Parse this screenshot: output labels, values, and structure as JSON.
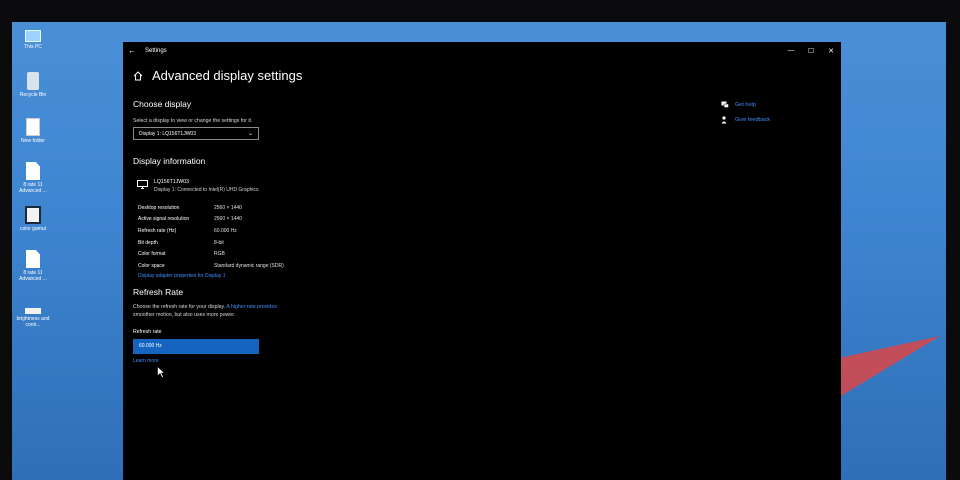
{
  "desktop": {
    "icons": [
      {
        "label": "This PC",
        "glyph": "pc"
      },
      {
        "label": "Recycle Bin",
        "glyph": "bin"
      },
      {
        "label": "New folder",
        "glyph": "folder"
      },
      {
        "label": "8 rate 11 Advanced ...",
        "glyph": "doc"
      },
      {
        "label": "color gamut",
        "glyph": "img"
      },
      {
        "label": "8 rate 11 Advanced ...",
        "glyph": "doc"
      },
      {
        "label": "brightness and contr...",
        "glyph": "white"
      }
    ]
  },
  "window": {
    "title": "Settings",
    "back_glyph": "←",
    "minimize_glyph": "—",
    "maximize_glyph": "☐",
    "close_glyph": "✕"
  },
  "page": {
    "title": "Advanced display settings",
    "choose_display": {
      "heading": "Choose display",
      "description": "Select a display to view or change the settings for it.",
      "selected": "Display 1: LQ156T1JW03"
    },
    "display_info": {
      "heading": "Display information",
      "name": "LQ156T1JW03",
      "connection": "Display 1: Connected to Intel(R) UHD Graphics",
      "rows": [
        {
          "key": "Desktop resolution",
          "value": "2560 × 1440"
        },
        {
          "key": "Active signal resolution",
          "value": "2560 × 1440"
        },
        {
          "key": "Refresh rate (Hz)",
          "value": "60.000 Hz"
        },
        {
          "key": "Bit depth",
          "value": "8-bit"
        },
        {
          "key": "Color format",
          "value": "RGB"
        },
        {
          "key": "Color space",
          "value": "Standard dynamic range (SDR)"
        }
      ],
      "adapter_link": "Display adapter properties for Display 1"
    },
    "refresh_rate": {
      "heading": "Refresh Rate",
      "description": "Choose the refresh rate for your display. ",
      "description_link": "A higher rate provides",
      "description_end": "smoother motion, but also uses more power.",
      "label": "Refresh rate",
      "selected": "60.000 Hz",
      "learn_more": "Learn more"
    }
  },
  "help": {
    "get_help": "Get help",
    "give_feedback": "Give feedback"
  },
  "colors": {
    "accent": "#1565c0",
    "link": "#3b8fff",
    "window_bg": "#000000",
    "desktop_bg": "#3f86d2"
  }
}
